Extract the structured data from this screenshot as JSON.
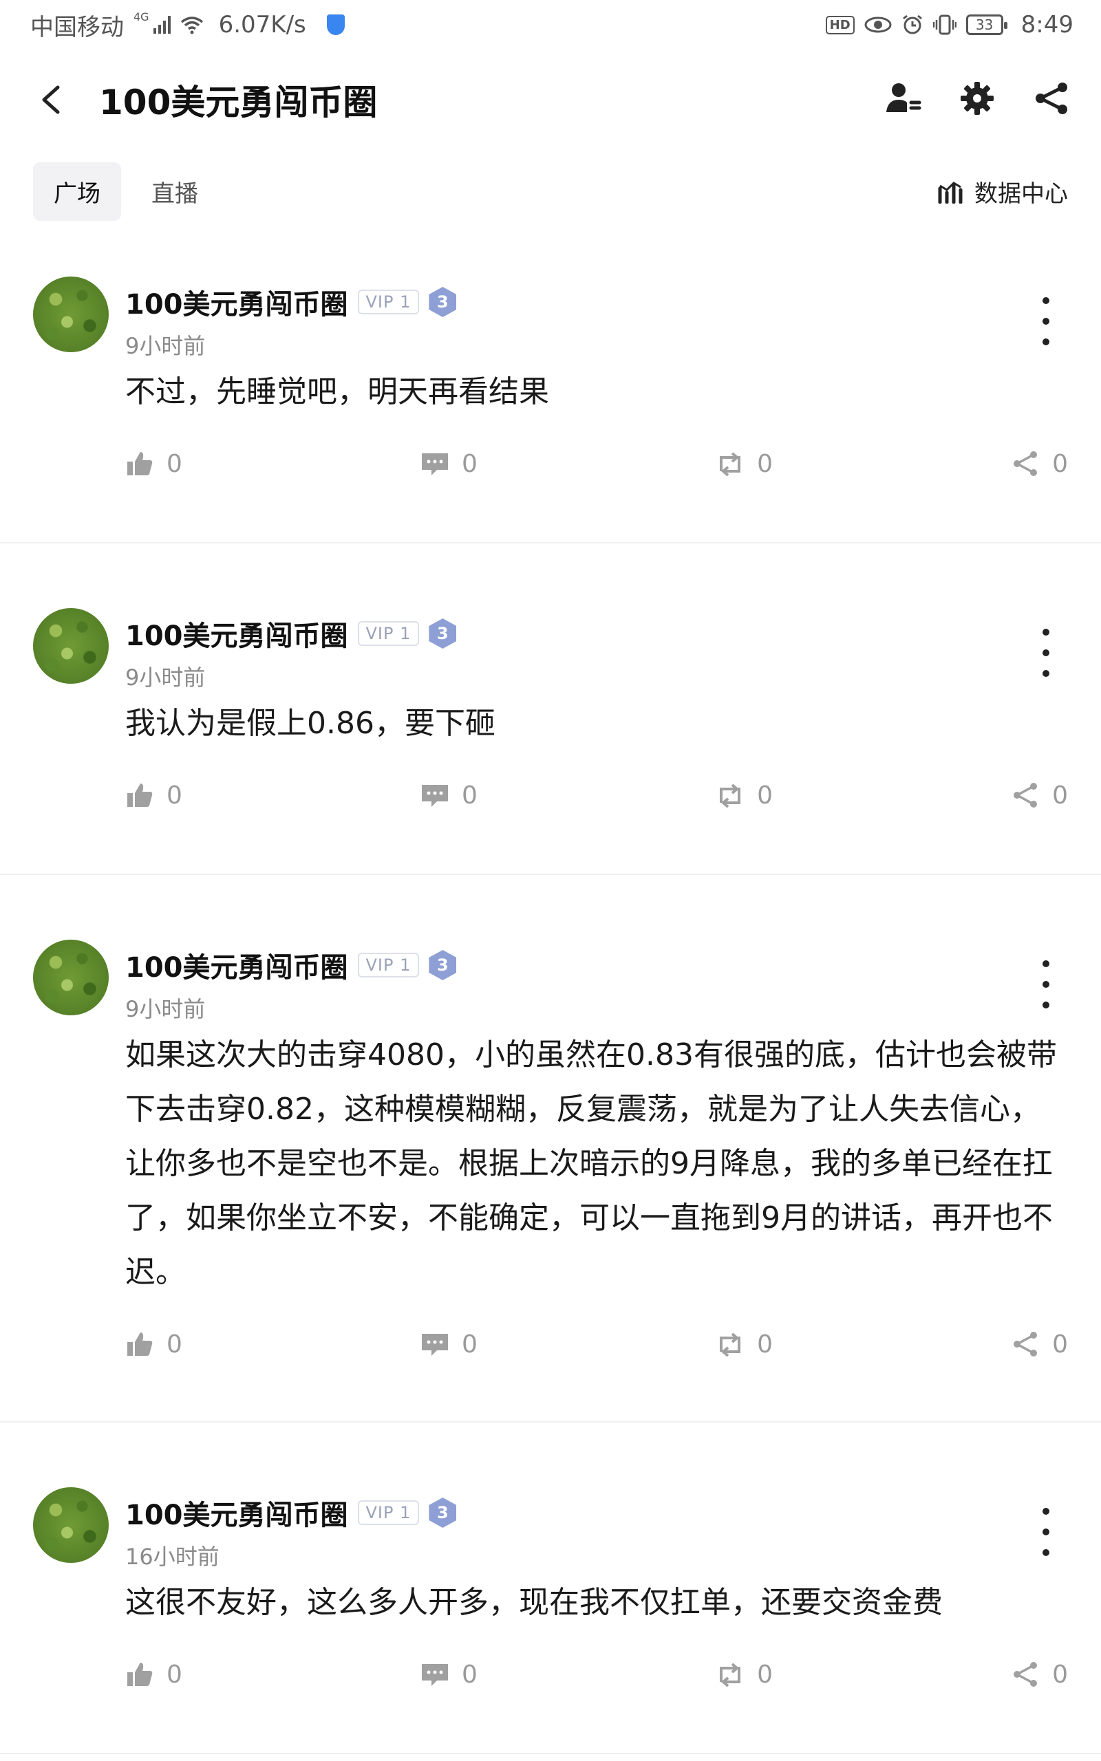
{
  "status_bar": {
    "carrier": "中国移动",
    "network": "4G",
    "speed": "6.07K/s",
    "hd": "HD",
    "battery": "33",
    "time": "8:49"
  },
  "header": {
    "title": "100美元勇闯币圈",
    "icons": [
      "back-icon",
      "members-icon",
      "settings-icon",
      "share-icon"
    ]
  },
  "tabs": {
    "items": [
      "广场",
      "直播"
    ],
    "active": "广场",
    "data_center": "数据中心"
  },
  "posts": [
    {
      "author": "100美元勇闯币圈",
      "vip": "VIP 1",
      "level": "3",
      "time": "9小时前",
      "content": "不过，先睡觉吧，明天再看结果",
      "likes": "0",
      "comments": "0",
      "reposts": "0",
      "shares": "0"
    },
    {
      "author": "100美元勇闯币圈",
      "vip": "VIP 1",
      "level": "3",
      "time": "9小时前",
      "content": "我认为是假上0.86，要下砸",
      "likes": "0",
      "comments": "0",
      "reposts": "0",
      "shares": "0"
    },
    {
      "author": "100美元勇闯币圈",
      "vip": "VIP 1",
      "level": "3",
      "time": "9小时前",
      "content": "如果这次大的击穿4080，小的虽然在0.83有很强的底，估计也会被带下去击穿0.82，这种模模糊糊，反复震荡，就是为了让人失去信心，让你多也不是空也不是。根据上次暗示的9月降息，我的多单已经在扛了，如果你坐立不安，不能确定，可以一直拖到9月的讲话，再开也不迟。",
      "likes": "0",
      "comments": "0",
      "reposts": "0",
      "shares": "0"
    },
    {
      "author": "100美元勇闯币圈",
      "vip": "VIP 1",
      "level": "3",
      "time": "16小时前",
      "content": "这很不友好，这么多人开多，现在我不仅扛单，还要交资金费",
      "likes": "0",
      "comments": "0",
      "reposts": "0",
      "shares": "0"
    }
  ],
  "colors": {
    "accent": "#111111",
    "muted": "#9a9a9a",
    "level_badge": "#8d9fd4"
  }
}
